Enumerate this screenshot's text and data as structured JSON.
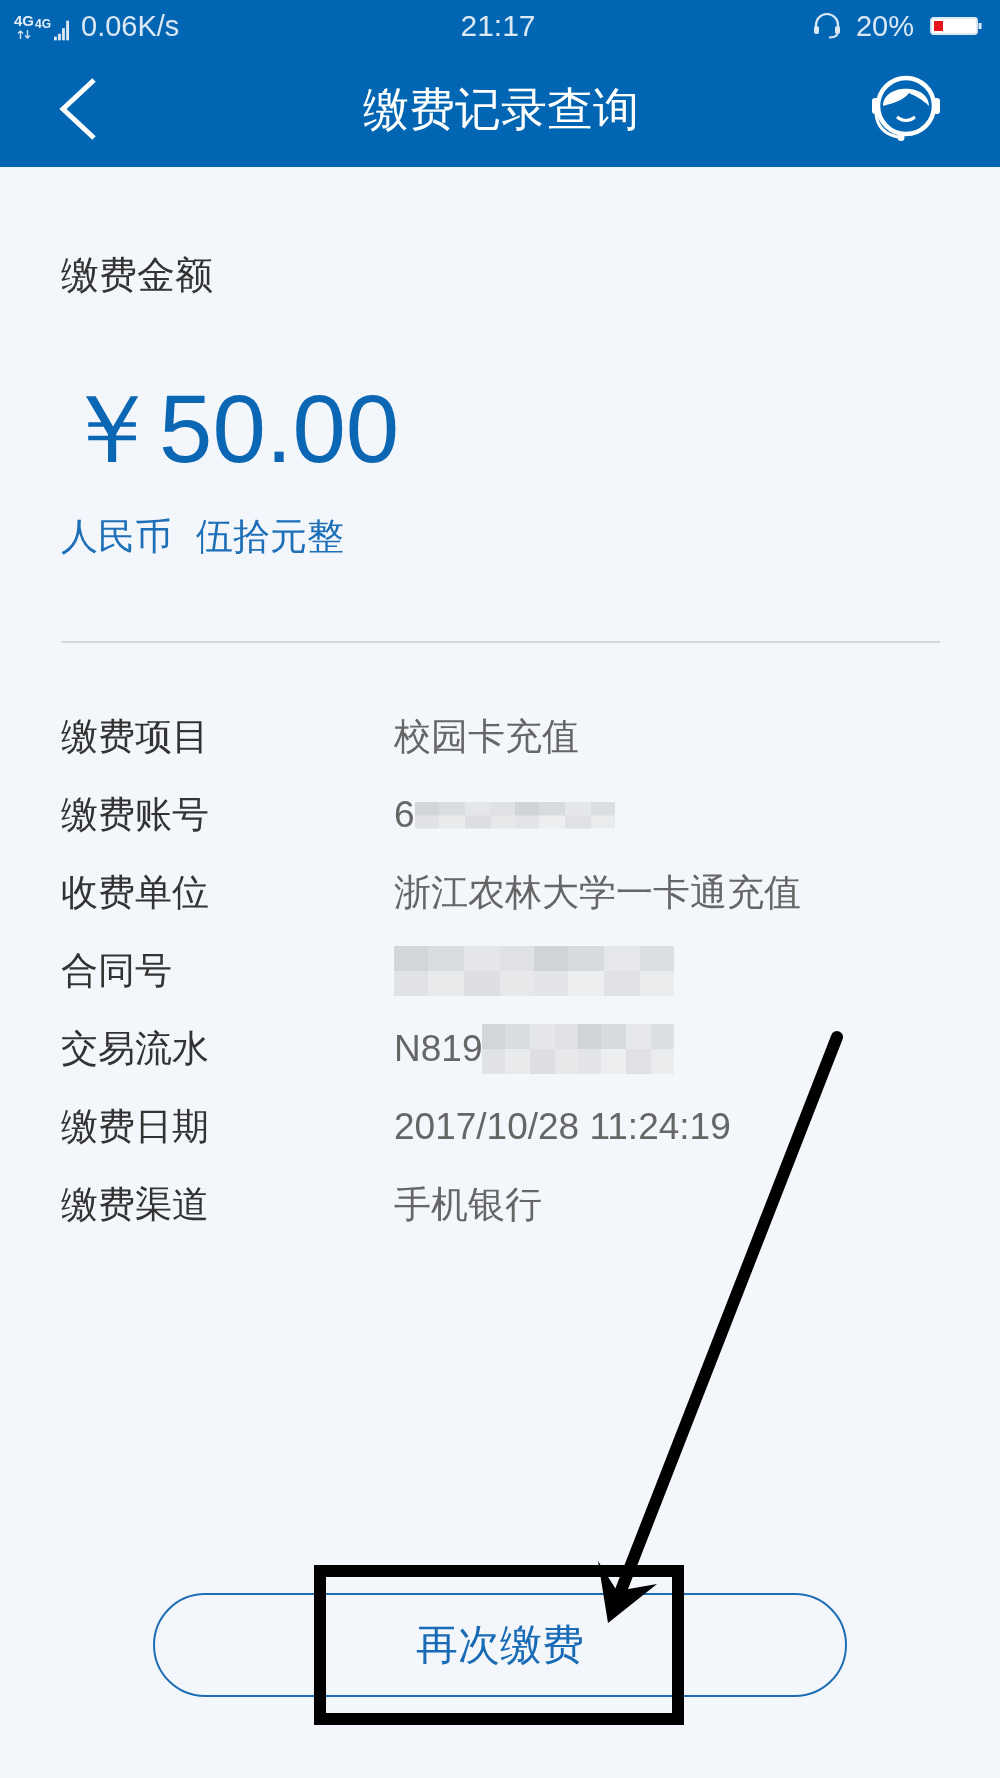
{
  "status_bar": {
    "network_labels": [
      "4G",
      "4G"
    ],
    "speed": "0.06K/s",
    "time": "21:17",
    "battery_percent": "20%"
  },
  "header": {
    "title": "缴费记录查询"
  },
  "amount_section": {
    "label": "缴费金额",
    "amount": "￥50.00",
    "currency": "人民币",
    "amount_in_words": "伍拾元整"
  },
  "details": [
    {
      "kind": "plain",
      "label": "缴费项目",
      "value": "校园卡充值"
    },
    {
      "kind": "strip",
      "label": "缴费账号",
      "value": "6"
    },
    {
      "kind": "plain",
      "label": "收费单位",
      "value": "浙江农林大学一卡通充值"
    },
    {
      "kind": "block",
      "label": "合同号"
    },
    {
      "kind": "block",
      "label": "交易流水",
      "value": "N819"
    },
    {
      "kind": "plain",
      "label": "缴费日期",
      "value": "2017/10/28 11:24:19"
    },
    {
      "kind": "plain",
      "label": "缴费渠道",
      "value": "手机银行"
    }
  ],
  "primary_button": {
    "label": "再次缴费"
  }
}
